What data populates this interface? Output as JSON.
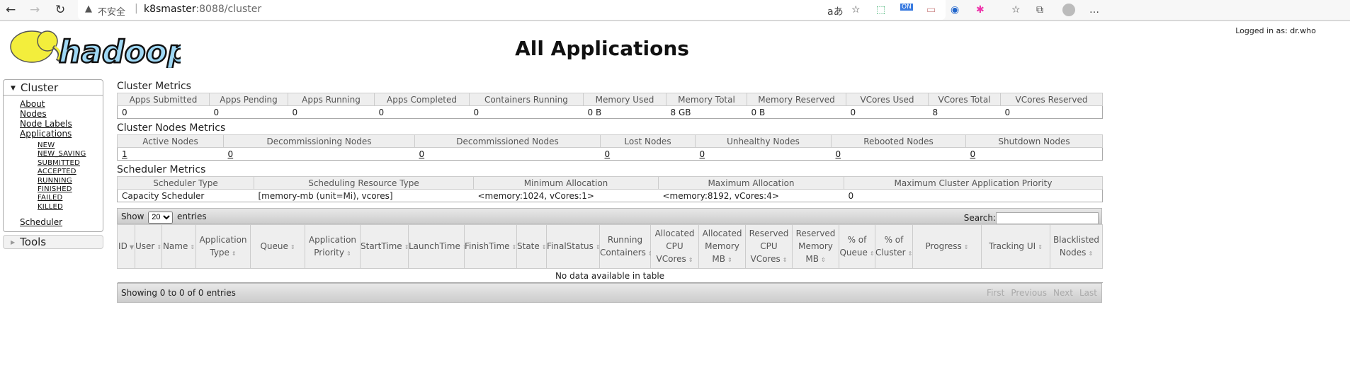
{
  "browser": {
    "back": "←",
    "forward": "→",
    "reload": "↻",
    "warning_icon": "warning-triangle",
    "insecure": "不安全",
    "url_host": "k8smaster",
    "url_rest": ":8088/cluster",
    "read_aloud": "aあ"
  },
  "header": {
    "logo_text": "hadoop",
    "logged_in": "Logged in as: dr.who",
    "title": "All Applications"
  },
  "sidebar": {
    "cluster": "Cluster",
    "items": [
      "About",
      "Nodes",
      "Node Labels",
      "Applications"
    ],
    "states": [
      "NEW",
      "NEW_SAVING",
      "SUBMITTED",
      "ACCEPTED",
      "RUNNING",
      "FINISHED",
      "FAILED",
      "KILLED"
    ],
    "scheduler": "Scheduler",
    "tools": "Tools"
  },
  "cluster_metrics": {
    "title": "Cluster Metrics",
    "headers": [
      "Apps Submitted",
      "Apps Pending",
      "Apps Running",
      "Apps Completed",
      "Containers Running",
      "Memory Used",
      "Memory Total",
      "Memory Reserved",
      "VCores Used",
      "VCores Total",
      "VCores Reserved"
    ],
    "values": [
      "0",
      "0",
      "0",
      "0",
      "0",
      "0 B",
      "8 GB",
      "0 B",
      "0",
      "8",
      "0"
    ]
  },
  "nodes_metrics": {
    "title": "Cluster Nodes Metrics",
    "headers": [
      "Active Nodes",
      "Decommissioning Nodes",
      "Decommissioned Nodes",
      "Lost Nodes",
      "Unhealthy Nodes",
      "Rebooted Nodes",
      "Shutdown Nodes"
    ],
    "values": [
      "1",
      "0",
      "0",
      "0",
      "0",
      "0",
      "0"
    ]
  },
  "scheduler_metrics": {
    "title": "Scheduler Metrics",
    "headers": [
      "Scheduler Type",
      "Scheduling Resource Type",
      "Minimum Allocation",
      "Maximum Allocation",
      "Maximum Cluster Application Priority"
    ],
    "values": [
      "Capacity Scheduler",
      "[memory-mb (unit=Mi), vcores]",
      "<memory:1024, vCores:1>",
      "<memory:8192, vCores:4>",
      "0"
    ]
  },
  "apps": {
    "show": "Show",
    "entries_value": "20",
    "entries": "entries",
    "search": "Search:",
    "search_value": "",
    "headers": [
      "ID",
      "User",
      "Name",
      "Application Type",
      "Queue",
      "Application Priority",
      "StartTime",
      "LaunchTime",
      "FinishTime",
      "State",
      "FinalStatus",
      "Running Containers",
      "Allocated CPU VCores",
      "Allocated Memory MB",
      "Reserved CPU VCores",
      "Reserved Memory MB",
      "% of Queue",
      "% of Cluster",
      "Progress",
      "Tracking UI",
      "Blacklisted Nodes"
    ],
    "empty": "No data available in table",
    "info": "Showing 0 to 0 of 0 entries",
    "pager": [
      "First",
      "Previous",
      "Next",
      "Last"
    ]
  }
}
